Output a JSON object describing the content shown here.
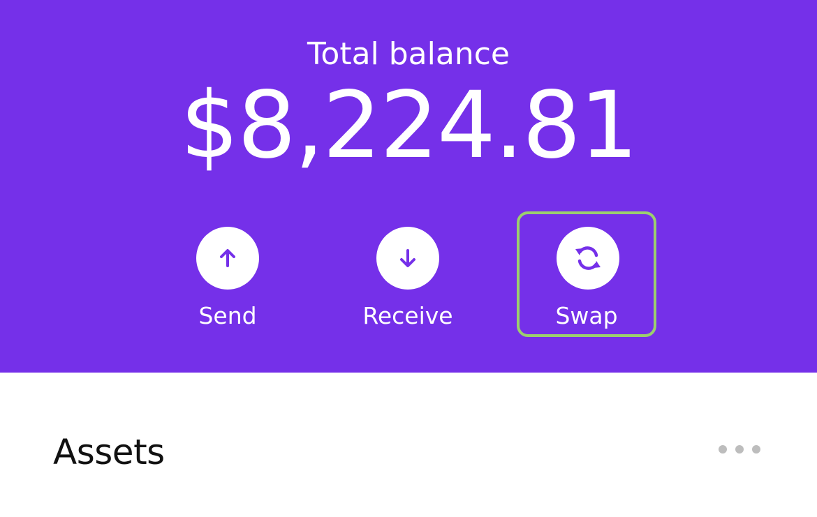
{
  "balance": {
    "label": "Total balance",
    "amount": "$8,224.81"
  },
  "actions": [
    {
      "label": "Send",
      "icon": "arrow-up-icon"
    },
    {
      "label": "Receive",
      "icon": "arrow-down-icon"
    },
    {
      "label": "Swap",
      "icon": "swap-icon"
    }
  ],
  "assets": {
    "title": "Assets",
    "more_icon": "more-horizontal-icon"
  },
  "colors": {
    "brand": "#7530E9",
    "highlight": "#9CCF6E",
    "dots": "#BDBDBD"
  }
}
